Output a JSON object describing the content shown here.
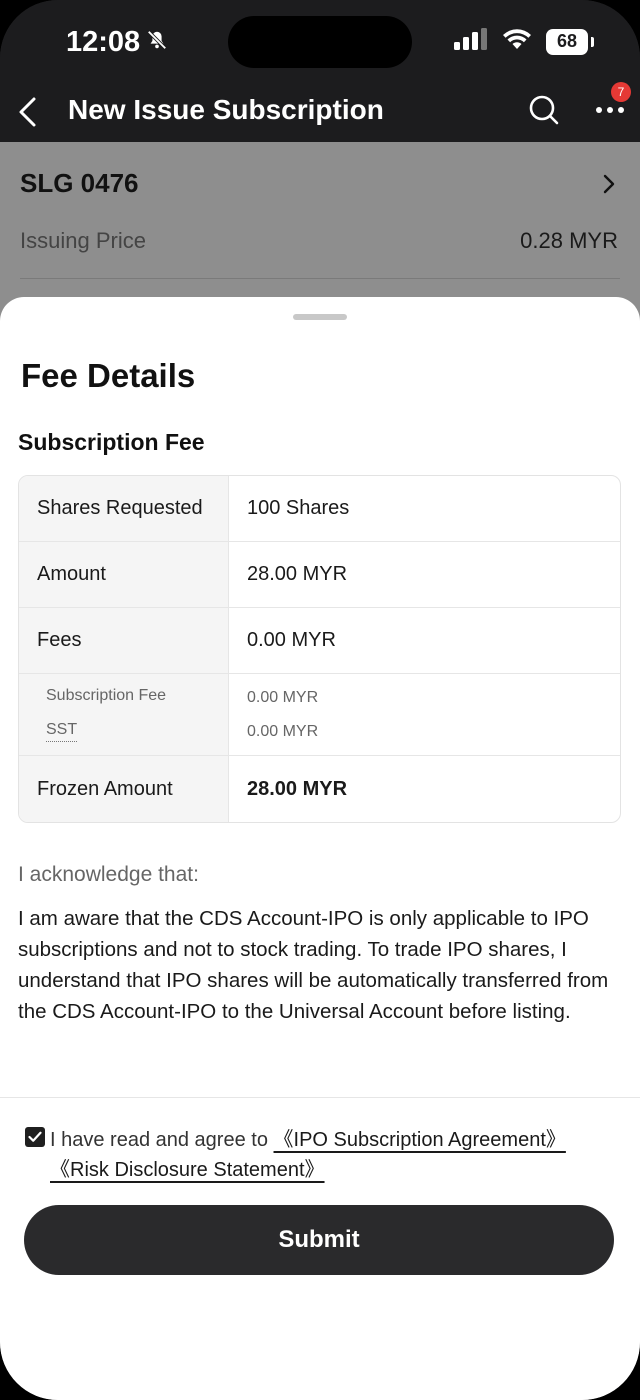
{
  "status_bar": {
    "time": "12:08",
    "battery": "68"
  },
  "nav": {
    "title": "New Issue Subscription",
    "badge_count": "7"
  },
  "page": {
    "stock_code": "SLG 0476",
    "price_label": "Issuing Price",
    "price_value": "0.28 MYR"
  },
  "sheet": {
    "title": "Fee Details",
    "section_title": "Subscription Fee",
    "rows": [
      {
        "label": "Shares Requested",
        "value": "100 Shares"
      },
      {
        "label": "Amount",
        "value": "28.00 MYR"
      },
      {
        "label": "Fees",
        "value": "0.00 MYR"
      }
    ],
    "sub_fees": [
      {
        "label": "Subscription Fee",
        "value": "0.00 MYR"
      },
      {
        "label": "SST",
        "value": "0.00 MYR"
      }
    ],
    "frozen": {
      "label": "Frozen Amount",
      "value": "28.00 MYR"
    },
    "ack_label": "I acknowledge that:",
    "ack_text": "I am aware that the CDS Account-IPO is only applicable to IPO subscriptions and not to stock trading. To trade IPO shares, I understand that IPO shares will be automatically transferred from the CDS Account-IPO to the Universal Account before listing.",
    "agree_prefix": "I have read and agree to",
    "agreement_link": "《IPO Subscription Agreement》",
    "risk_link": "《Risk Disclosure Statement》",
    "submit_label": "Submit"
  },
  "colors": {
    "dark": "#1c1c1e",
    "badge": "#e53935",
    "button": "#2a2a2c"
  },
  "icons": [
    "bell-slash-icon",
    "signal-icon",
    "wifi-icon",
    "battery-icon",
    "back-arrow-icon",
    "search-icon",
    "more-icon",
    "chevron-right-icon",
    "checkmark-icon"
  ]
}
